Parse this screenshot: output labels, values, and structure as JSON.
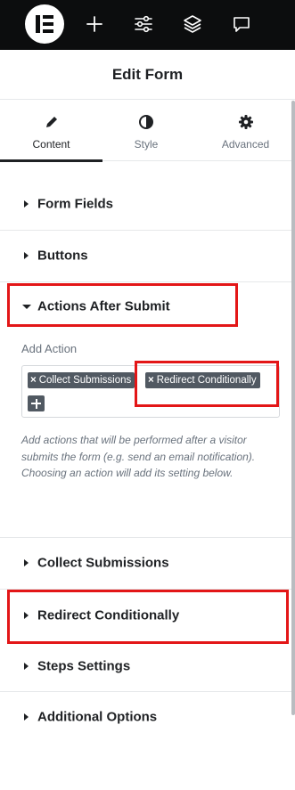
{
  "topbar": {
    "logo": "elementor-logo",
    "icons": [
      "plus-icon",
      "sliders-icon",
      "layers-icon",
      "comment-icon"
    ]
  },
  "header": {
    "title": "Edit Form"
  },
  "tabs": [
    {
      "label": "Content",
      "icon": "pencil-icon",
      "active": true
    },
    {
      "label": "Style",
      "icon": "half-circle-icon",
      "active": false
    },
    {
      "label": "Advanced",
      "icon": "gear-icon",
      "active": false
    }
  ],
  "sections": {
    "form_fields": "Form Fields",
    "buttons": "Buttons",
    "actions_after_submit": "Actions After Submit",
    "collect_submissions": "Collect Submissions",
    "redirect_conditionally": "Redirect Conditionally",
    "steps_settings": "Steps Settings",
    "additional_options": "Additional Options"
  },
  "actions_panel": {
    "label": "Add Action",
    "remove_glyph": "×",
    "tags": [
      "Collect Submissions",
      "Redirect Conditionally"
    ],
    "help_text": "Add actions that will be performed after a visitor submits the form (e.g. send an email notification). Choosing an action will add its setting below."
  },
  "colors": {
    "topbar": "#0c0d0e",
    "highlight": "#e31617",
    "tag": "#515962",
    "text": "#1f2124",
    "muted": "#69727d"
  }
}
